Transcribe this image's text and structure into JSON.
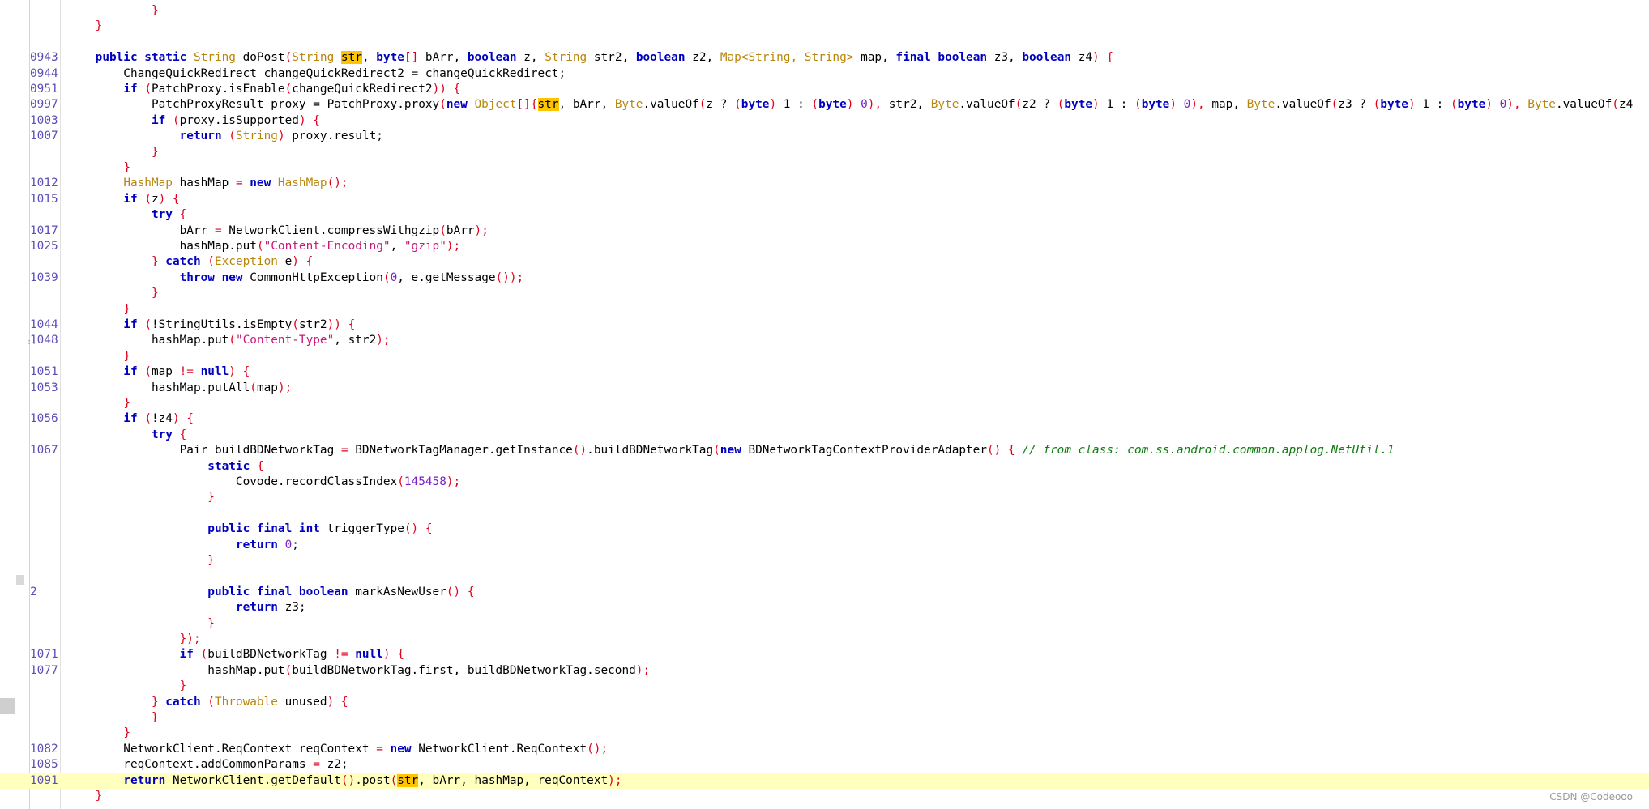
{
  "editor": {
    "watermark": "CSDN @Codeooo",
    "highlight_color": "#ffffbe",
    "match_color": "#ffc400"
  },
  "lines": [
    {
      "n": "",
      "code": [
        [
          "            ",
          "plain"
        ],
        [
          "}",
          "brace"
        ]
      ]
    },
    {
      "n": "",
      "code": [
        [
          "    ",
          "plain"
        ],
        [
          "}",
          "brace"
        ]
      ]
    },
    {
      "n": "",
      "code": []
    },
    {
      "n": "0943",
      "code": [
        [
          "    ",
          "plain"
        ],
        [
          "public static ",
          "kw"
        ],
        [
          "String ",
          "type"
        ],
        [
          "doPost",
          "plain"
        ],
        [
          "(",
          "brace"
        ],
        [
          "String ",
          "type"
        ],
        [
          "str",
          "mark"
        ],
        [
          ", ",
          "plain"
        ],
        [
          "byte",
          "kw"
        ],
        [
          "[] ",
          "brace"
        ],
        [
          "bArr, ",
          "plain"
        ],
        [
          "boolean ",
          "kw"
        ],
        [
          "z, ",
          "plain"
        ],
        [
          "String ",
          "type"
        ],
        [
          "str2, ",
          "plain"
        ],
        [
          "boolean ",
          "kw"
        ],
        [
          "z2, ",
          "plain"
        ],
        [
          "Map<String, String> ",
          "type"
        ],
        [
          "map, ",
          "plain"
        ],
        [
          "final boolean ",
          "kw"
        ],
        [
          "z3, ",
          "plain"
        ],
        [
          "boolean ",
          "kw"
        ],
        [
          "z4",
          "plain"
        ],
        [
          ") {",
          "brace"
        ]
      ]
    },
    {
      "n": "0944",
      "code": [
        [
          "        ChangeQuickRedirect changeQuickRedirect2 = changeQuickRedirect;",
          "plain"
        ]
      ]
    },
    {
      "n": "0951",
      "code": [
        [
          "        ",
          "plain"
        ],
        [
          "if ",
          "kw"
        ],
        [
          "(",
          "brace"
        ],
        [
          "PatchProxy.isEnable",
          "plain"
        ],
        [
          "(",
          "brace"
        ],
        [
          "changeQuickRedirect2",
          "plain"
        ],
        [
          ")) {",
          "brace"
        ]
      ]
    },
    {
      "n": "0997",
      "code": [
        [
          "            PatchProxyResult proxy = PatchProxy.proxy",
          "plain"
        ],
        [
          "(",
          "brace"
        ],
        [
          "new ",
          "kw"
        ],
        [
          "Object",
          "type"
        ],
        [
          "[]{",
          "brace"
        ],
        [
          "str",
          "mark"
        ],
        [
          ", bArr, ",
          "plain"
        ],
        [
          "Byte",
          "type"
        ],
        [
          ".valueOf",
          "plain"
        ],
        [
          "(",
          "brace"
        ],
        [
          "z ? ",
          "plain"
        ],
        [
          "(",
          "brace"
        ],
        [
          "byte",
          "kw"
        ],
        [
          ") ",
          "brace"
        ],
        [
          "1 : ",
          "plain"
        ],
        [
          "(",
          "brace"
        ],
        [
          "byte",
          "kw"
        ],
        [
          ") ",
          "brace"
        ],
        [
          "0",
          "num"
        ],
        [
          "), ",
          "brace"
        ],
        [
          "str2, ",
          "plain"
        ],
        [
          "Byte",
          "type"
        ],
        [
          ".valueOf",
          "plain"
        ],
        [
          "(",
          "brace"
        ],
        [
          "z2 ? ",
          "plain"
        ],
        [
          "(",
          "brace"
        ],
        [
          "byte",
          "kw"
        ],
        [
          ") ",
          "brace"
        ],
        [
          "1 : ",
          "plain"
        ],
        [
          "(",
          "brace"
        ],
        [
          "byte",
          "kw"
        ],
        [
          ") ",
          "brace"
        ],
        [
          "0",
          "num"
        ],
        [
          "), ",
          "brace"
        ],
        [
          "map, ",
          "plain"
        ],
        [
          "Byte",
          "type"
        ],
        [
          ".valueOf",
          "plain"
        ],
        [
          "(",
          "brace"
        ],
        [
          "z3 ? ",
          "plain"
        ],
        [
          "(",
          "brace"
        ],
        [
          "byte",
          "kw"
        ],
        [
          ") ",
          "brace"
        ],
        [
          "1 : ",
          "plain"
        ],
        [
          "(",
          "brace"
        ],
        [
          "byte",
          "kw"
        ],
        [
          ") ",
          "brace"
        ],
        [
          "0",
          "num"
        ],
        [
          "), ",
          "brace"
        ],
        [
          "Byte",
          "type"
        ],
        [
          ".valueOf",
          "plain"
        ],
        [
          "(",
          "brace"
        ],
        [
          "z4",
          "plain"
        ]
      ]
    },
    {
      "n": "1003",
      "code": [
        [
          "            ",
          "plain"
        ],
        [
          "if ",
          "kw"
        ],
        [
          "(",
          "brace"
        ],
        [
          "proxy.isSupported",
          "plain"
        ],
        [
          ") {",
          "brace"
        ]
      ]
    },
    {
      "n": "1007",
      "code": [
        [
          "                ",
          "plain"
        ],
        [
          "return ",
          "kw"
        ],
        [
          "(",
          "brace"
        ],
        [
          "String",
          "type"
        ],
        [
          ") ",
          "brace"
        ],
        [
          "proxy.result;",
          "plain"
        ]
      ]
    },
    {
      "n": "",
      "code": [
        [
          "            ",
          "plain"
        ],
        [
          "}",
          "brace"
        ]
      ]
    },
    {
      "n": "",
      "code": [
        [
          "        ",
          "plain"
        ],
        [
          "}",
          "brace"
        ]
      ]
    },
    {
      "n": "1012",
      "code": [
        [
          "        ",
          "plain"
        ],
        [
          "HashMap ",
          "type"
        ],
        [
          "hashMap ",
          "plain"
        ],
        [
          "= ",
          "brace"
        ],
        [
          "new ",
          "kw"
        ],
        [
          "HashMap",
          "type"
        ],
        [
          "();",
          "brace"
        ]
      ]
    },
    {
      "n": "1015",
      "code": [
        [
          "        ",
          "plain"
        ],
        [
          "if ",
          "kw"
        ],
        [
          "(",
          "brace"
        ],
        [
          "z",
          "plain"
        ],
        [
          ") {",
          "brace"
        ]
      ]
    },
    {
      "n": "",
      "code": [
        [
          "            ",
          "plain"
        ],
        [
          "try ",
          "kw"
        ],
        [
          "{",
          "brace"
        ]
      ]
    },
    {
      "n": "1017",
      "code": [
        [
          "                bArr ",
          "plain"
        ],
        [
          "= ",
          "brace"
        ],
        [
          "NetworkClient.compressWithgzip",
          "plain"
        ],
        [
          "(",
          "brace"
        ],
        [
          "bArr",
          "plain"
        ],
        [
          ");",
          "brace"
        ]
      ]
    },
    {
      "n": "1025",
      "code": [
        [
          "                hashMap.put",
          "plain"
        ],
        [
          "(",
          "brace"
        ],
        [
          "\"Content-Encoding\"",
          "str"
        ],
        [
          ", ",
          "plain"
        ],
        [
          "\"gzip\"",
          "str"
        ],
        [
          ");",
          "brace"
        ]
      ]
    },
    {
      "n": "",
      "code": [
        [
          "            ",
          "plain"
        ],
        [
          "} ",
          "brace"
        ],
        [
          "catch ",
          "kw"
        ],
        [
          "(",
          "brace"
        ],
        [
          "Exception ",
          "type"
        ],
        [
          "e",
          "plain"
        ],
        [
          ") {",
          "brace"
        ]
      ]
    },
    {
      "n": "1039",
      "code": [
        [
          "                ",
          "plain"
        ],
        [
          "throw new ",
          "kw"
        ],
        [
          "CommonHttpException",
          "plain"
        ],
        [
          "(",
          "brace"
        ],
        [
          "0",
          "num"
        ],
        [
          ", e.getMessage",
          "plain"
        ],
        [
          "());",
          "brace"
        ]
      ]
    },
    {
      "n": "",
      "code": [
        [
          "            ",
          "plain"
        ],
        [
          "}",
          "brace"
        ]
      ]
    },
    {
      "n": "",
      "code": [
        [
          "        ",
          "plain"
        ],
        [
          "}",
          "brace"
        ]
      ]
    },
    {
      "n": "1044",
      "code": [
        [
          "        ",
          "plain"
        ],
        [
          "if ",
          "kw"
        ],
        [
          "(",
          "brace"
        ],
        [
          "!StringUtils.isEmpty",
          "plain"
        ],
        [
          "(",
          "brace"
        ],
        [
          "str2",
          "plain"
        ],
        [
          ")) {",
          "brace"
        ]
      ]
    },
    {
      "n": "1048",
      "code": [
        [
          "            hashMap.put",
          "plain"
        ],
        [
          "(",
          "brace"
        ],
        [
          "\"Content-Type\"",
          "str"
        ],
        [
          ", str2",
          "plain"
        ],
        [
          ");",
          "brace"
        ]
      ]
    },
    {
      "n": "",
      "code": [
        [
          "        ",
          "plain"
        ],
        [
          "}",
          "brace"
        ]
      ]
    },
    {
      "n": "1051",
      "code": [
        [
          "        ",
          "plain"
        ],
        [
          "if ",
          "kw"
        ],
        [
          "(",
          "brace"
        ],
        [
          "map ",
          "plain"
        ],
        [
          "!= ",
          "brace"
        ],
        [
          "null",
          "kw"
        ],
        [
          ") {",
          "brace"
        ]
      ]
    },
    {
      "n": "1053",
      "code": [
        [
          "            hashMap.putAll",
          "plain"
        ],
        [
          "(",
          "brace"
        ],
        [
          "map",
          "plain"
        ],
        [
          ");",
          "brace"
        ]
      ]
    },
    {
      "n": "",
      "code": [
        [
          "        ",
          "plain"
        ],
        [
          "}",
          "brace"
        ]
      ]
    },
    {
      "n": "1056",
      "code": [
        [
          "        ",
          "plain"
        ],
        [
          "if ",
          "kw"
        ],
        [
          "(",
          "brace"
        ],
        [
          "!z4",
          "plain"
        ],
        [
          ") {",
          "brace"
        ]
      ]
    },
    {
      "n": "",
      "code": [
        [
          "            ",
          "plain"
        ],
        [
          "try ",
          "kw"
        ],
        [
          "{",
          "brace"
        ]
      ]
    },
    {
      "n": "1067",
      "code": [
        [
          "                Pair buildBDNetworkTag ",
          "plain"
        ],
        [
          "= ",
          "brace"
        ],
        [
          "BDNetworkTagManager.getInstance",
          "plain"
        ],
        [
          "()",
          "brace"
        ],
        [
          ".buildBDNetworkTag",
          "plain"
        ],
        [
          "(",
          "brace"
        ],
        [
          "new ",
          "kw"
        ],
        [
          "BDNetworkTagContextProviderAdapter",
          "plain"
        ],
        [
          "() { ",
          "brace"
        ],
        [
          "// from class: com.ss.android.common.applog.NetUtil.1",
          "comment"
        ]
      ]
    },
    {
      "n": "",
      "code": [
        [
          "                    ",
          "plain"
        ],
        [
          "static ",
          "kw"
        ],
        [
          "{",
          "brace"
        ]
      ]
    },
    {
      "n": "",
      "code": [
        [
          "                        Covode.recordClassIndex",
          "plain"
        ],
        [
          "(",
          "brace"
        ],
        [
          "145458",
          "num"
        ],
        [
          ");",
          "brace"
        ]
      ]
    },
    {
      "n": "",
      "code": [
        [
          "                    ",
          "plain"
        ],
        [
          "}",
          "brace"
        ]
      ]
    },
    {
      "n": "",
      "code": []
    },
    {
      "n": "",
      "code": [
        [
          "                    ",
          "plain"
        ],
        [
          "public final int ",
          "kw"
        ],
        [
          "triggerType",
          "plain"
        ],
        [
          "() {",
          "brace"
        ]
      ]
    },
    {
      "n": "",
      "code": [
        [
          "                        ",
          "plain"
        ],
        [
          "return ",
          "kw"
        ],
        [
          "0",
          "num"
        ],
        [
          ";",
          "plain"
        ]
      ]
    },
    {
      "n": "",
      "code": [
        [
          "                    ",
          "plain"
        ],
        [
          "}",
          "brace"
        ]
      ]
    },
    {
      "n": "",
      "code": []
    },
    {
      "n": "2",
      "code": [
        [
          "                    ",
          "plain"
        ],
        [
          "public final boolean ",
          "kw"
        ],
        [
          "markAsNewUser",
          "plain"
        ],
        [
          "() {",
          "brace"
        ]
      ]
    },
    {
      "n": "",
      "code": [
        [
          "                        ",
          "plain"
        ],
        [
          "return ",
          "kw"
        ],
        [
          "z3;",
          "plain"
        ]
      ]
    },
    {
      "n": "",
      "code": [
        [
          "                    ",
          "plain"
        ],
        [
          "}",
          "brace"
        ]
      ]
    },
    {
      "n": "",
      "code": [
        [
          "                ",
          "plain"
        ],
        [
          "});",
          "brace"
        ]
      ]
    },
    {
      "n": "1071",
      "code": [
        [
          "                ",
          "plain"
        ],
        [
          "if ",
          "kw"
        ],
        [
          "(",
          "brace"
        ],
        [
          "buildBDNetworkTag ",
          "plain"
        ],
        [
          "!= ",
          "brace"
        ],
        [
          "null",
          "kw"
        ],
        [
          ") {",
          "brace"
        ]
      ]
    },
    {
      "n": "1077",
      "code": [
        [
          "                    hashMap.put",
          "plain"
        ],
        [
          "(",
          "brace"
        ],
        [
          "buildBDNetworkTag.first, buildBDNetworkTag.second",
          "plain"
        ],
        [
          ");",
          "brace"
        ]
      ]
    },
    {
      "n": "",
      "code": [
        [
          "                ",
          "plain"
        ],
        [
          "}",
          "brace"
        ]
      ]
    },
    {
      "n": "",
      "code": [
        [
          "            ",
          "plain"
        ],
        [
          "} ",
          "brace"
        ],
        [
          "catch ",
          "kw"
        ],
        [
          "(",
          "brace"
        ],
        [
          "Throwable ",
          "type"
        ],
        [
          "unused",
          "plain"
        ],
        [
          ") {",
          "brace"
        ]
      ]
    },
    {
      "n": "",
      "code": [
        [
          "            ",
          "plain"
        ],
        [
          "}",
          "brace"
        ]
      ]
    },
    {
      "n": "",
      "code": [
        [
          "        ",
          "plain"
        ],
        [
          "}",
          "brace"
        ]
      ]
    },
    {
      "n": "1082",
      "code": [
        [
          "        NetworkClient.ReqContext reqContext ",
          "plain"
        ],
        [
          "= ",
          "brace"
        ],
        [
          "new ",
          "kw"
        ],
        [
          "NetworkClient.ReqContext",
          "plain"
        ],
        [
          "();",
          "brace"
        ]
      ]
    },
    {
      "n": "1085",
      "code": [
        [
          "        reqContext.addCommonParams ",
          "plain"
        ],
        [
          "= ",
          "brace"
        ],
        [
          "z2;",
          "plain"
        ]
      ]
    },
    {
      "n": "1091",
      "hl": true,
      "code": [
        [
          "        ",
          "plain"
        ],
        [
          "return ",
          "kw"
        ],
        [
          "NetworkClient.getDefault",
          "plain"
        ],
        [
          "()",
          "brace"
        ],
        [
          ".post",
          "plain"
        ],
        [
          "(",
          "brace"
        ],
        [
          "str",
          "mark"
        ],
        [
          ", bArr, hashMap, reqContext",
          "plain"
        ],
        [
          ");",
          "brace"
        ]
      ]
    },
    {
      "n": "",
      "code": [
        [
          "    ",
          "plain"
        ],
        [
          "}",
          "brace"
        ]
      ]
    }
  ]
}
